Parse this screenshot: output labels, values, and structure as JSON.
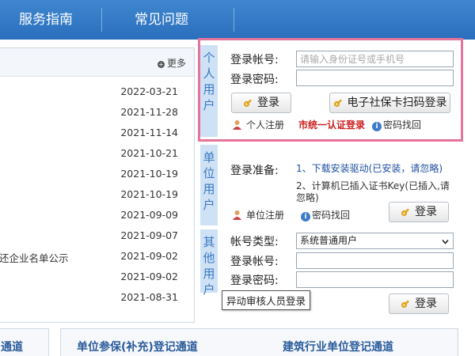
{
  "nav": {
    "items": [
      "服务指南",
      "常见问题"
    ]
  },
  "news": {
    "more_label": "更多",
    "items": [
      {
        "title": "",
        "date": "2022-03-21"
      },
      {
        "title": "",
        "date": "2021-11-28"
      },
      {
        "title": "",
        "date": "2021-11-14"
      },
      {
        "title": "",
        "date": "2021-10-21"
      },
      {
        "title": "",
        "date": "2021-10-19"
      },
      {
        "title": "",
        "date": "2021-10-19"
      },
      {
        "title": "",
        "date": "2021-09-09"
      },
      {
        "title": "",
        "date": "2021-09-07"
      },
      {
        "title": "还企业名单公示",
        "date": "2021-09-02"
      },
      {
        "title": "",
        "date": "2021-09-02"
      },
      {
        "title": "",
        "date": "2021-08-31"
      }
    ]
  },
  "personal": {
    "side_label": "个人用户",
    "account_label": "登录帐号:",
    "account_placeholder": "请输入身份证号或手机号",
    "password_label": "登录密码:",
    "login_button": "登录",
    "scan_button": "电子社保卡扫码登录",
    "register_link": "个人注册",
    "unified_auth_link": "市统一认证登录",
    "recover_link": "密码找回"
  },
  "unit": {
    "side_label": "单位用户",
    "prep_label": "登录准备:",
    "step1": "1、下载安装驱动(已安装，请忽略)",
    "step2": "2、计算机已插入证书Key(已插入,请忽略)",
    "register_link": "单位注册",
    "recover_link": "密码找回",
    "login_button": "登录"
  },
  "other": {
    "side_label": "其他用户",
    "type_label": "帐号类型:",
    "type_selected": "系统普通用户",
    "account_label": "登录帐号:",
    "password_label": "登录密码:",
    "tooltip": "异动审核人员登录",
    "login_button": "登录"
  },
  "bottom": {
    "left": "通道",
    "middle": "单位参保(补充)登记通道",
    "right": "建筑行业单位登记通道"
  },
  "colors": {
    "nav_blue": "#2a6fbd",
    "highlight_pink": "#e5739b",
    "side_bg": "#cfe2f5",
    "link_blue": "#1f4fa0",
    "link_red": "#cc1f1f"
  }
}
